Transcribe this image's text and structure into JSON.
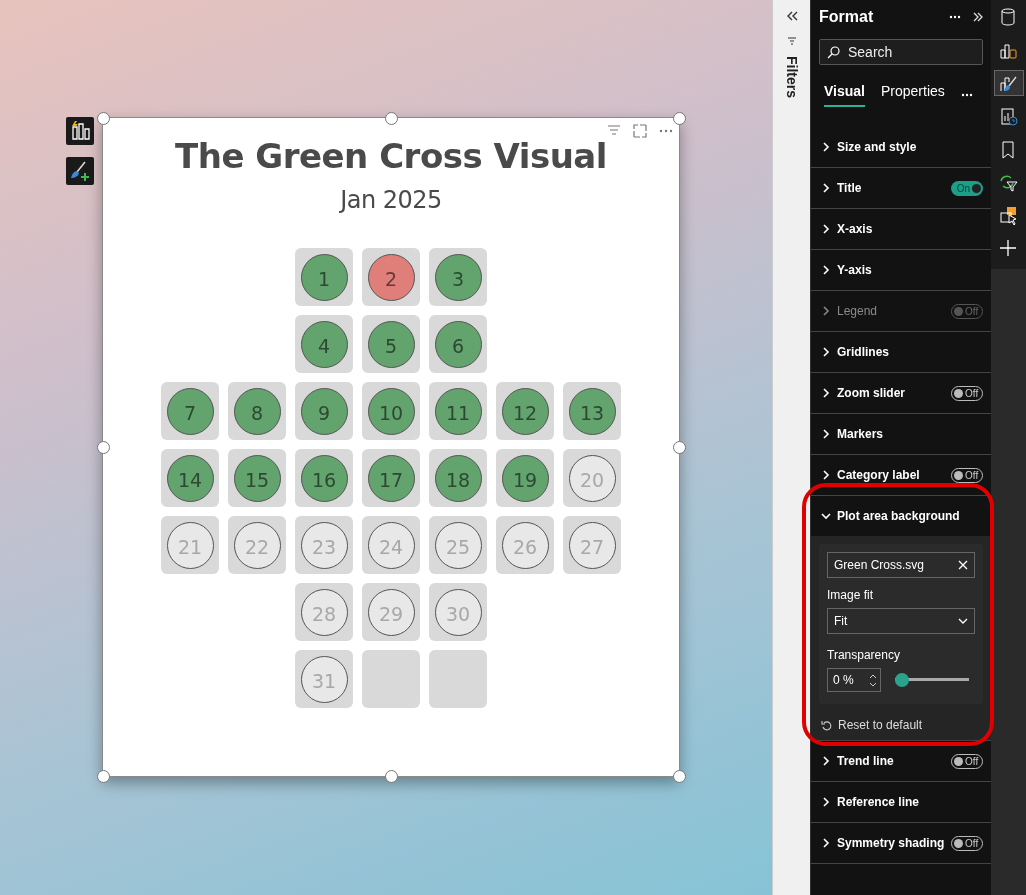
{
  "canvas": {
    "visual": {
      "title": "The Green Cross Visual",
      "subtitle": "Jan 2025",
      "grid": [
        [
          {
            "kind": "gap"
          },
          {
            "kind": "gap"
          },
          {
            "kind": "day",
            "label": "1",
            "color": "#62a36e"
          },
          {
            "kind": "day",
            "label": "2",
            "color": "#e07e7a"
          },
          {
            "kind": "day",
            "label": "3",
            "color": "#62a36e"
          },
          {
            "kind": "gap"
          },
          {
            "kind": "gap"
          }
        ],
        [
          {
            "kind": "gap"
          },
          {
            "kind": "gap"
          },
          {
            "kind": "day",
            "label": "4",
            "color": "#62a36e"
          },
          {
            "kind": "day",
            "label": "5",
            "color": "#62a36e"
          },
          {
            "kind": "day",
            "label": "6",
            "color": "#62a36e"
          },
          {
            "kind": "gap"
          },
          {
            "kind": "gap"
          }
        ],
        [
          {
            "kind": "day",
            "label": "7",
            "color": "#62a36e"
          },
          {
            "kind": "day",
            "label": "8",
            "color": "#62a36e"
          },
          {
            "kind": "day",
            "label": "9",
            "color": "#62a36e"
          },
          {
            "kind": "day",
            "label": "10",
            "color": "#62a36e"
          },
          {
            "kind": "day",
            "label": "11",
            "color": "#62a36e"
          },
          {
            "kind": "day",
            "label": "12",
            "color": "#62a36e"
          },
          {
            "kind": "day",
            "label": "13",
            "color": "#62a36e"
          }
        ],
        [
          {
            "kind": "day",
            "label": "14",
            "color": "#62a36e"
          },
          {
            "kind": "day",
            "label": "15",
            "color": "#62a36e"
          },
          {
            "kind": "day",
            "label": "16",
            "color": "#62a36e"
          },
          {
            "kind": "day",
            "label": "17",
            "color": "#62a36e"
          },
          {
            "kind": "day",
            "label": "18",
            "color": "#62a36e"
          },
          {
            "kind": "day",
            "label": "19",
            "color": "#62a36e"
          },
          {
            "kind": "day",
            "label": "20",
            "color": "#e8e8e8"
          }
        ],
        [
          {
            "kind": "day",
            "label": "21",
            "color": "#e8e8e8"
          },
          {
            "kind": "day",
            "label": "22",
            "color": "#e8e8e8"
          },
          {
            "kind": "day",
            "label": "23",
            "color": "#e8e8e8"
          },
          {
            "kind": "day",
            "label": "24",
            "color": "#e8e8e8"
          },
          {
            "kind": "day",
            "label": "25",
            "color": "#e8e8e8"
          },
          {
            "kind": "day",
            "label": "26",
            "color": "#e8e8e8"
          },
          {
            "kind": "day",
            "label": "27",
            "color": "#e8e8e8"
          }
        ],
        [
          {
            "kind": "gap"
          },
          {
            "kind": "gap"
          },
          {
            "kind": "day",
            "label": "28",
            "color": "#e8e8e8"
          },
          {
            "kind": "day",
            "label": "29",
            "color": "#e8e8e8"
          },
          {
            "kind": "day",
            "label": "30",
            "color": "#e8e8e8"
          },
          {
            "kind": "gap"
          },
          {
            "kind": "gap"
          }
        ],
        [
          {
            "kind": "gap"
          },
          {
            "kind": "gap"
          },
          {
            "kind": "day",
            "label": "31",
            "color": "#e8e8e8"
          },
          {
            "kind": "empty"
          },
          {
            "kind": "empty"
          },
          {
            "kind": "gap"
          },
          {
            "kind": "gap"
          }
        ]
      ]
    }
  },
  "filters_pane": {
    "label": "Filters"
  },
  "format_pane": {
    "title": "Format",
    "search": {
      "placeholder": "Search"
    },
    "tabs": [
      {
        "label": "Visual",
        "selected": true
      },
      {
        "label": "Properties",
        "selected": false
      }
    ],
    "sections": [
      {
        "label": "Size and style",
        "expanded": false,
        "disabled": false
      },
      {
        "label": "Title",
        "expanded": false,
        "disabled": false,
        "toggle": {
          "on": true,
          "text": "On"
        }
      },
      {
        "label": "X-axis",
        "expanded": false,
        "disabled": false
      },
      {
        "label": "Y-axis",
        "expanded": false,
        "disabled": false
      },
      {
        "label": "Legend",
        "expanded": false,
        "disabled": true,
        "toggle": {
          "on": false,
          "text": "Off"
        }
      },
      {
        "label": "Gridlines",
        "expanded": false,
        "disabled": false
      },
      {
        "label": "Zoom slider",
        "expanded": false,
        "disabled": false,
        "toggle": {
          "on": false,
          "text": "Off"
        }
      },
      {
        "label": "Markers",
        "expanded": false,
        "disabled": false
      },
      {
        "label": "Category label",
        "expanded": false,
        "disabled": false,
        "toggle": {
          "on": false,
          "text": "Off"
        }
      },
      {
        "label": "Plot area background",
        "expanded": true,
        "disabled": false,
        "content": {
          "file": {
            "value": "Green Cross.svg"
          },
          "image_fit": {
            "label": "Image fit",
            "value": "Fit"
          },
          "transparency": {
            "label": "Transparency",
            "value": "0 %",
            "level": 0
          },
          "reset": "Reset to default"
        }
      },
      {
        "label": "Trend line",
        "expanded": false,
        "disabled": false,
        "toggle": {
          "on": false,
          "text": "Off"
        }
      },
      {
        "label": "Reference line",
        "expanded": false,
        "disabled": false
      },
      {
        "label": "Symmetry shading",
        "expanded": false,
        "disabled": false,
        "toggle": {
          "on": false,
          "text": "Off"
        }
      }
    ]
  }
}
